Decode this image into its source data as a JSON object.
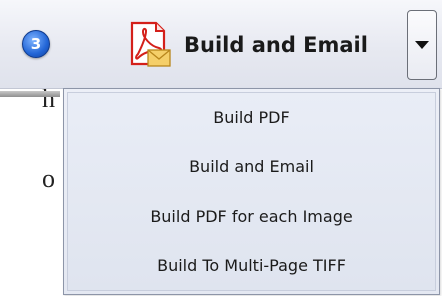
{
  "background": {
    "fragment_1": "h",
    "fragment_2": "o"
  },
  "toolbar": {
    "step_number": "3",
    "main_button_label": "Build and Email",
    "main_button_icon": "pdf-email-icon",
    "dropdown_icon": "chevron-down-icon"
  },
  "menu": {
    "items": [
      {
        "label": "Build PDF"
      },
      {
        "label": "Build and Email"
      },
      {
        "label": "Build PDF for each Image"
      },
      {
        "label": "Build To Multi-Page TIFF"
      }
    ]
  },
  "colors": {
    "badge": "#2265d6",
    "pdf_icon": "#d4201a",
    "envelope": "#f2c14e",
    "menu_border": "#8d95a8"
  }
}
